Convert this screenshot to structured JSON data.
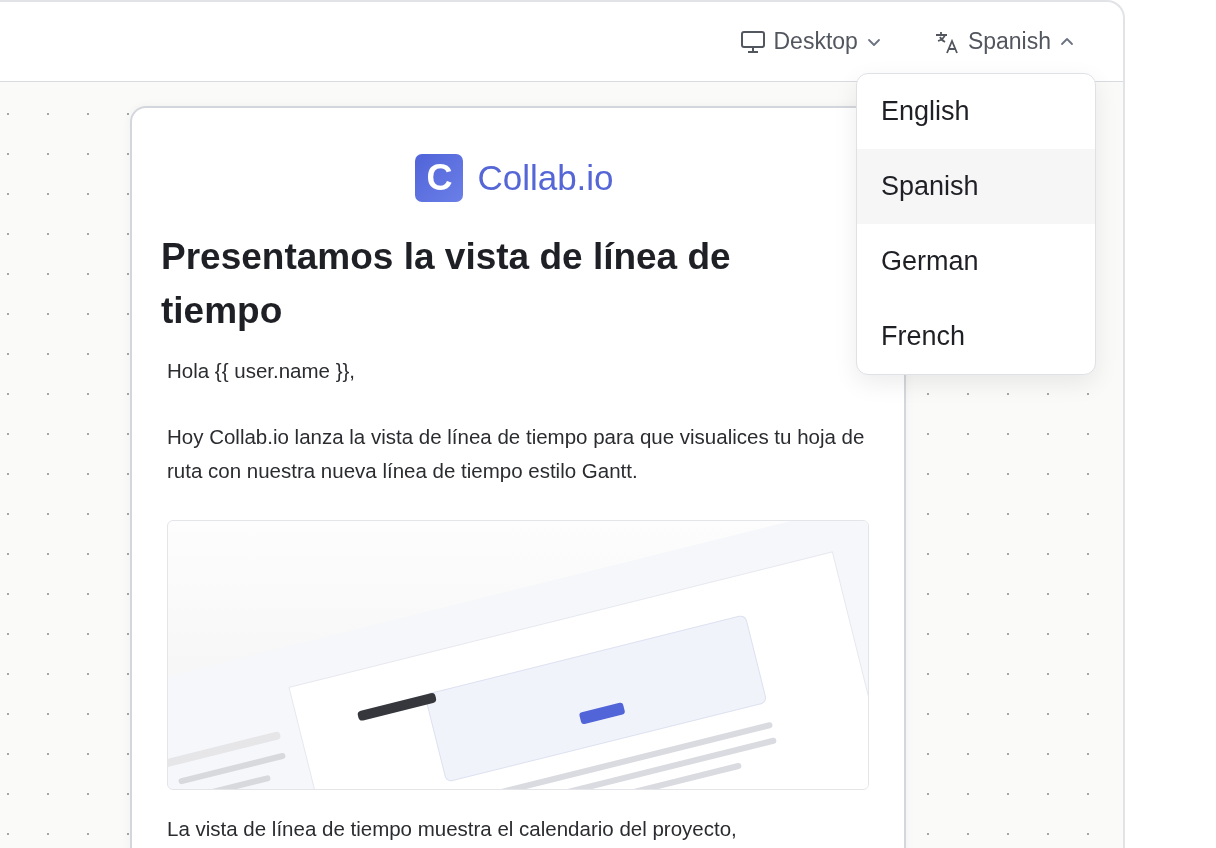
{
  "toolbar": {
    "device": {
      "label": "Desktop",
      "expanded": false
    },
    "language": {
      "label": "Spanish",
      "expanded": true
    }
  },
  "language_menu": [
    {
      "label": "English",
      "selected": false
    },
    {
      "label": "Spanish",
      "selected": true
    },
    {
      "label": "German",
      "selected": false
    },
    {
      "label": "French",
      "selected": false
    }
  ],
  "email": {
    "logo_letter": "C",
    "brand": "Collab.io",
    "heading": "Presentamos la vista de línea de tiempo",
    "greeting": "Hola {{ user.name }},",
    "paragraphs": [
      "Hoy Collab.io lanza la vista de línea de tiempo para que visualices tu hoja de ruta con nuestra nueva línea de tiempo estilo Gantt.",
      "La vista de línea de tiempo muestra el calendario del proyecto,"
    ]
  }
}
